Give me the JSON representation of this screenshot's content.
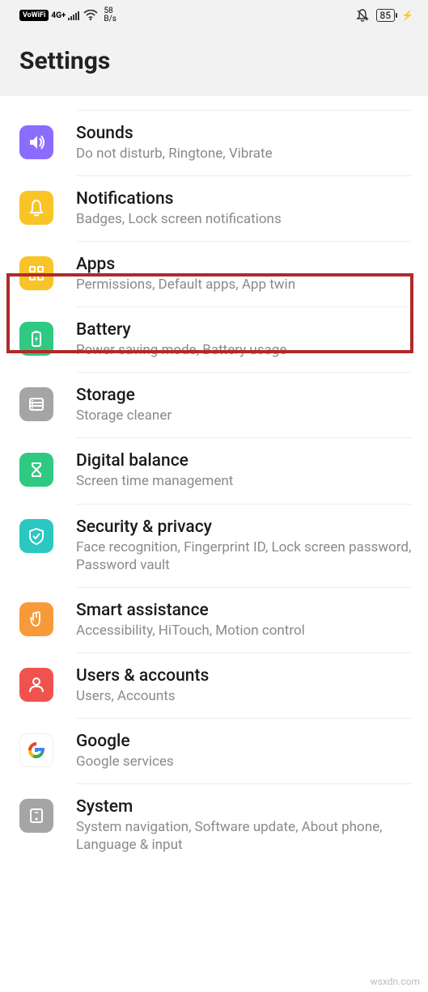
{
  "status": {
    "vowifi": "VoWiFi",
    "net_type": "4G+",
    "speed_num": "58",
    "speed_unit": "B/s",
    "battery": "85"
  },
  "header": {
    "title": "Settings"
  },
  "items": [
    {
      "title": "Sounds",
      "sub": "Do not disturb, Ringtone, Vibrate",
      "color": "#8a6cff"
    },
    {
      "title": "Notifications",
      "sub": "Badges, Lock screen notifications",
      "color": "#f8c427"
    },
    {
      "title": "Apps",
      "sub": "Permissions, Default apps, App twin",
      "color": "#f8c427"
    },
    {
      "title": "Battery",
      "sub": "Power saving mode, Battery usage",
      "color": "#2fc982"
    },
    {
      "title": "Storage",
      "sub": "Storage cleaner",
      "color": "#a5a5a5"
    },
    {
      "title": "Digital balance",
      "sub": "Screen time management",
      "color": "#2fc982"
    },
    {
      "title": "Security & privacy",
      "sub": "Face recognition, Fingerprint ID, Lock screen password, Password vault",
      "color": "#2bc8c1"
    },
    {
      "title": "Smart assistance",
      "sub": "Accessibility, HiTouch, Motion control",
      "color": "#f89a3a"
    },
    {
      "title": "Users & accounts",
      "sub": "Users, Accounts",
      "color": "#f0534e"
    },
    {
      "title": "Google",
      "sub": "Google services",
      "color": "#ffffff"
    },
    {
      "title": "System",
      "sub": "System navigation, Software update, About phone, Language & input",
      "color": "#a5a5a5"
    }
  ],
  "watermark": "wsxdn.com"
}
